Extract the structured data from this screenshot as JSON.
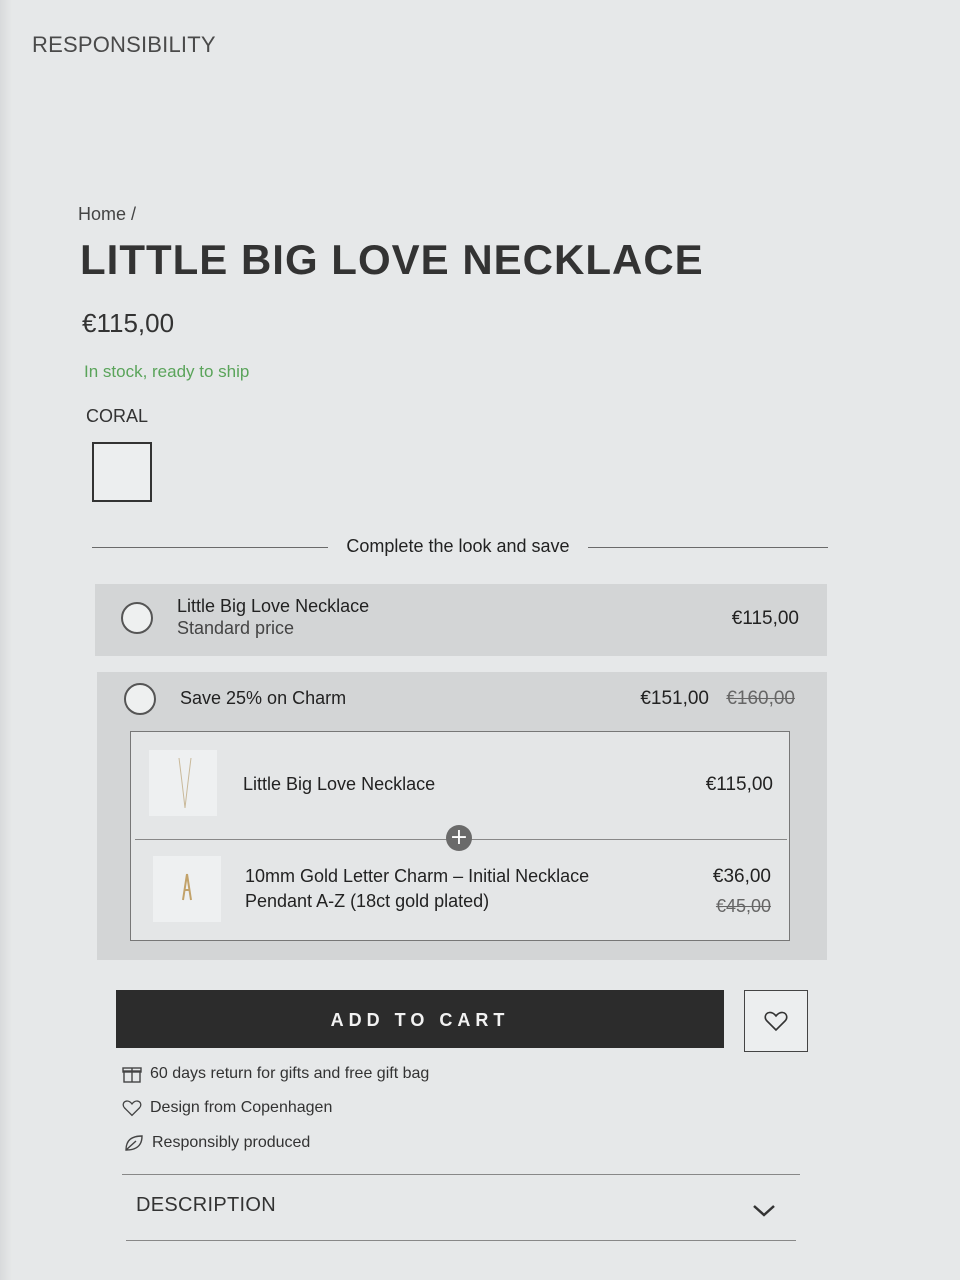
{
  "nav": {
    "top_link": "RESPONSIBILITY"
  },
  "breadcrumb": {
    "text": "Home /"
  },
  "product": {
    "title": "LITTLE BIG LOVE NECKLACE",
    "price": "€115,00",
    "stock_status": "In stock, ready to ship",
    "color_label": "CORAL",
    "stock_color": "#5aa45a"
  },
  "bundle": {
    "heading": "Complete the look and save",
    "option1": {
      "name": "Little Big Love Necklace",
      "sub": "Standard price",
      "price": "€115,00"
    },
    "option2": {
      "name": "Save 25% on Charm",
      "price": "€151,00",
      "old_price": "€160,00",
      "items": [
        {
          "name": "Little Big Love Necklace",
          "price": "€115,00"
        },
        {
          "name_line1": "10mm Gold Letter Charm – Initial Necklace",
          "name_line2": "Pendant A-Z (18ct gold plated)",
          "price": "€36,00",
          "old_price": "€45,00"
        }
      ]
    }
  },
  "cart": {
    "add_label": "ADD TO CART",
    "wishlist_icon": "heart-icon"
  },
  "features": [
    {
      "icon": "gift-icon",
      "text": "60 days return for gifts and free gift bag"
    },
    {
      "icon": "heart-icon",
      "text": "Design from Copenhagen"
    },
    {
      "icon": "leaf-icon",
      "text": "Responsibly produced"
    }
  ],
  "accordion": {
    "description_label": "DESCRIPTION"
  }
}
